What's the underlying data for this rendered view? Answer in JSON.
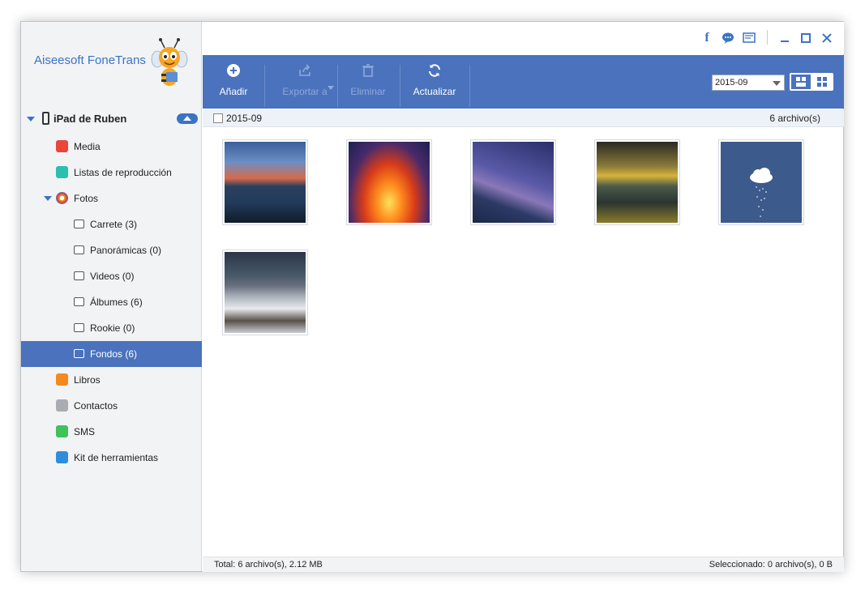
{
  "app": {
    "title": "Aiseesoft FoneTrans"
  },
  "device": {
    "name": "iPad de Ruben"
  },
  "sidebar": {
    "items": [
      {
        "label": "Media"
      },
      {
        "label": "Listas de reproducción"
      },
      {
        "label": "Fotos"
      },
      {
        "label": "Carrete (3)"
      },
      {
        "label": "Panorámicas (0)"
      },
      {
        "label": "Videos (0)"
      },
      {
        "label": "Álbumes (6)"
      },
      {
        "label": "Rookie (0)"
      },
      {
        "label": "Fondos (6)"
      },
      {
        "label": "Libros"
      },
      {
        "label": "Contactos"
      },
      {
        "label": "SMS"
      },
      {
        "label": "Kit de herramientas"
      }
    ]
  },
  "toolbar": {
    "add_label": "Añadir",
    "export_label": "Exportar a",
    "delete_label": "Eliminar",
    "refresh_label": "Actualizar",
    "date_select": "2015-09"
  },
  "content": {
    "group_date": "2015-09",
    "file_count": "6 archivo(s)"
  },
  "status": {
    "total": "Total: 6 archivo(s), 2.12 MB",
    "selected": "Seleccionado: 0 archivo(s), 0 B"
  },
  "colors": {
    "accent": "#4a72bd",
    "brand_text": "#3b73c5"
  }
}
